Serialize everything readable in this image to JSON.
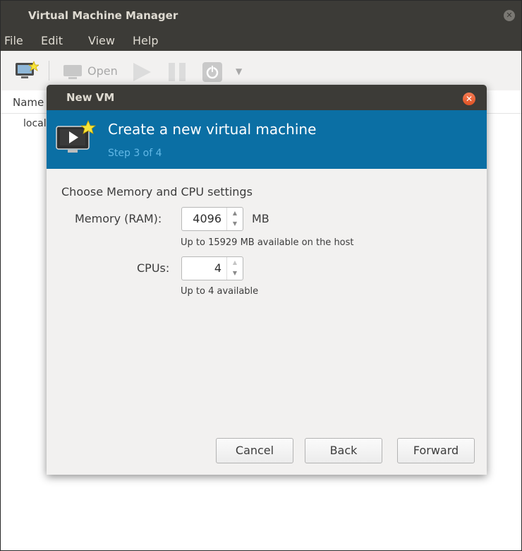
{
  "app": {
    "title": "Virtual Machine Manager",
    "close_icon": "close-icon"
  },
  "menubar": {
    "items": [
      "File",
      "Edit",
      "View",
      "Help"
    ]
  },
  "toolbar": {
    "new_vm_icon": "computer-star-icon",
    "open_label": "Open",
    "icons": [
      "monitor-icon",
      "play-icon",
      "pause-icon",
      "power-icon",
      "dropdown-arrow-icon"
    ]
  },
  "vm_list": {
    "column_name": "Name",
    "rows": [
      "localhost (QEMU/KVM)"
    ],
    "visible_row_text": "local"
  },
  "dialog": {
    "title": "New VM",
    "banner_title": "Create a new virtual machine",
    "banner_step": "Step 3 of 4",
    "banner_color": "#0b6fa4",
    "section_label": "Choose Memory and CPU settings",
    "memory": {
      "label": "Memory (RAM):",
      "value": "4096",
      "unit": "MB",
      "hint": "Up to 15929 MB available on the host"
    },
    "cpus": {
      "label": "CPUs:",
      "value": "4",
      "hint": "Up to 4 available"
    },
    "buttons": {
      "cancel": "Cancel",
      "back": "Back",
      "forward": "Forward"
    }
  }
}
